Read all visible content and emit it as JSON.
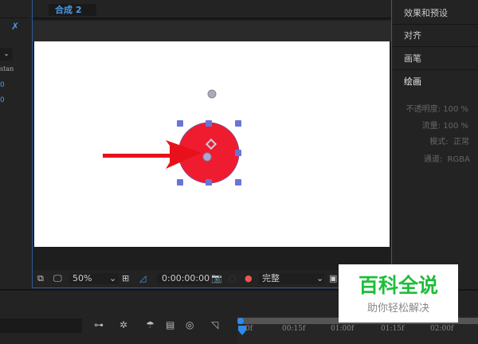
{
  "left_panel": {
    "text_partial": "stan",
    "values": [
      "0",
      "0"
    ]
  },
  "composition": {
    "tab_label": "合成 2"
  },
  "toolbar": {
    "zoom": "50%",
    "timecode": "0:00:00:00",
    "resolution": "完整"
  },
  "right_panel": {
    "items": [
      "效果和预设",
      "对齐",
      "画笔",
      "绘画"
    ],
    "paint": {
      "opacity_label": "不透明度:",
      "opacity": "100 %",
      "flow_label": "流量:",
      "flow": "100 %",
      "mode_label": "模式:",
      "mode": "正常",
      "channel_label": "通道:",
      "channel": "RGBA"
    }
  },
  "timeline": {
    "ticks": [
      "0f",
      "00:15f",
      "01:00f",
      "01:15f",
      "02:00f"
    ]
  },
  "watermark": {
    "title": "百科全说",
    "subtitle": "助你轻松解决"
  },
  "colors": {
    "accent": "#2d8ceb",
    "shape": "#ee1c2e",
    "arrow": "#e8111b",
    "handles": "#6a74d8"
  }
}
